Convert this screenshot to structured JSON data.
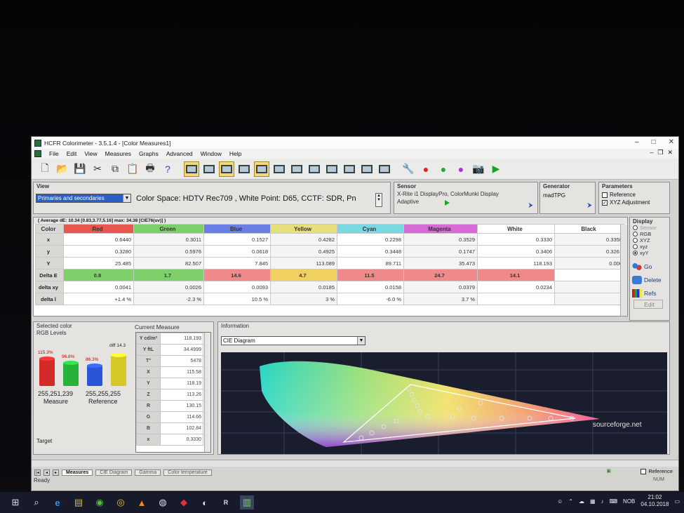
{
  "window": {
    "title": "HCFR Colorimeter - 3.5.1.4 - [Color Measures1]"
  },
  "menu": [
    "File",
    "Edit",
    "View",
    "Measures",
    "Graphs",
    "Advanced",
    "Window",
    "Help"
  ],
  "view": {
    "label": "View",
    "mode_selected": "Primaries and secondaries",
    "color_space_text": "Color Space: HDTV Rec709 , White Point: D65, CCTF: SDR, Pn"
  },
  "sensor": {
    "label": "Sensor",
    "device": "X-Rite i1 DisplayPro, ColorMunki Display",
    "mode": "Adaptive"
  },
  "generator": {
    "label": "Generator",
    "name": "madTPG"
  },
  "parameters": {
    "label": "Parameters",
    "reference_label": "Reference",
    "reference_checked": false,
    "xyz_label": "XYZ Adjustment",
    "xyz_checked": true
  },
  "table": {
    "caption": "( Average dE: 10.34 [0.83,3.77,5.16] max: 34.38 [CIE76(uv)] )",
    "columns": [
      {
        "name": "Color",
        "bg": "#d8d8d4"
      },
      {
        "name": "Red",
        "bg": "#e8574f"
      },
      {
        "name": "Green",
        "bg": "#7bd06a"
      },
      {
        "name": "Blue",
        "bg": "#6a7ee6"
      },
      {
        "name": "Yellow",
        "bg": "#e6e07a"
      },
      {
        "name": "Cyan",
        "bg": "#7ad8e0"
      },
      {
        "name": "Magenta",
        "bg": "#d86ad8"
      },
      {
        "name": "White",
        "bg": "#ffffff"
      },
      {
        "name": "Black",
        "bg": "#ffffff"
      }
    ],
    "rows": [
      {
        "label": "x",
        "cells": [
          "0.6440",
          "0.3011",
          "0.1527",
          "0.4282",
          "0.2298",
          "0.3529",
          "0.3330",
          "0.3358"
        ]
      },
      {
        "label": "y",
        "cells": [
          "0.3280",
          "0.5976",
          "0.0618",
          "0.4925",
          "0.3448",
          "0.1747",
          "0.3406",
          "0.3261"
        ]
      },
      {
        "label": "Y",
        "cells": [
          "25.485",
          "82.507",
          "7.845",
          "113.089",
          "89.711",
          "35.473",
          "118.193",
          "0.000"
        ]
      },
      {
        "label": "Delta E",
        "cells": [
          "0.8",
          "1.7",
          "14.6",
          "4.7",
          "11.5",
          "24.7",
          "14.1",
          ""
        ],
        "bgs": [
          "#7fd06a",
          "#7fd06a",
          "#f08a8a",
          "#f0d060",
          "#f08a8a",
          "#f08a8a",
          "#f08a8a",
          "#ffffff"
        ]
      },
      {
        "label": "delta xy",
        "cells": [
          "0.0041",
          "0.0026",
          "0.0093",
          "0.0185",
          "0.0158",
          "0.0379",
          "0.0234",
          ""
        ]
      },
      {
        "label": "delta l",
        "cells": [
          "+1.4 %",
          "-2.3 %",
          "10.5 %",
          "3 %",
          "-6.0 %",
          "3.7 %",
          "",
          ""
        ]
      }
    ]
  },
  "display_panel": {
    "label": "Display",
    "options": [
      {
        "label": "Sensor",
        "on": false,
        "disabled": true
      },
      {
        "label": "RGB",
        "on": false
      },
      {
        "label": "XYZ",
        "on": false
      },
      {
        "label": "xyz",
        "on": false
      },
      {
        "label": "xyY",
        "on": true
      }
    ],
    "buttons": {
      "go": "Go",
      "delete": "Delete",
      "refs": "Refs",
      "edit": "Edit"
    }
  },
  "selected_color": {
    "label": "Selected color",
    "rgb_levels_label": "RGB Levels",
    "diff_label": "diff 14.3",
    "bars": [
      {
        "pct_text": "115.3%",
        "level": 115.3,
        "color": "#d32a2a"
      },
      {
        "pct_text": "96.8%",
        "level": 96.8,
        "color": "#25b33b"
      },
      {
        "pct_text": "86.3%",
        "level": 86.3,
        "color": "#2a55d8"
      },
      {
        "pct_text": "",
        "level": 130,
        "color": "#d7c82a"
      }
    ],
    "measure_rgb": "255,251,239",
    "measure_label": "Measure",
    "reference_rgb": "255,255,255",
    "reference_label": "Reference",
    "target_label": "Target"
  },
  "current_measure": {
    "title": "Current Measure",
    "rows": [
      {
        "k": "Y cd/m²",
        "v": "118.193"
      },
      {
        "k": "Y ftL",
        "v": "34.4999"
      },
      {
        "k": "T°",
        "v": "5478"
      },
      {
        "k": "X",
        "v": "115.58"
      },
      {
        "k": "Y",
        "v": "118.19"
      },
      {
        "k": "Z",
        "v": "113.26"
      },
      {
        "k": "R",
        "v": "130.15"
      },
      {
        "k": "G",
        "v": "114.66"
      },
      {
        "k": "B",
        "v": "102.84"
      },
      {
        "k": "x",
        "v": "0.3330"
      }
    ]
  },
  "information": {
    "label": "Information",
    "selected": "CIE Diagram",
    "watermark": "sourceforge.net"
  },
  "bottom": {
    "tabs": [
      "Measures",
      "CIE Diagram",
      "Gamma",
      "Color temperature"
    ],
    "status": "Ready",
    "reference_label": "Reference",
    "num": "NUM"
  },
  "taskbar": {
    "language": "NOB",
    "time": "21:02",
    "date": "04.10.2018"
  }
}
